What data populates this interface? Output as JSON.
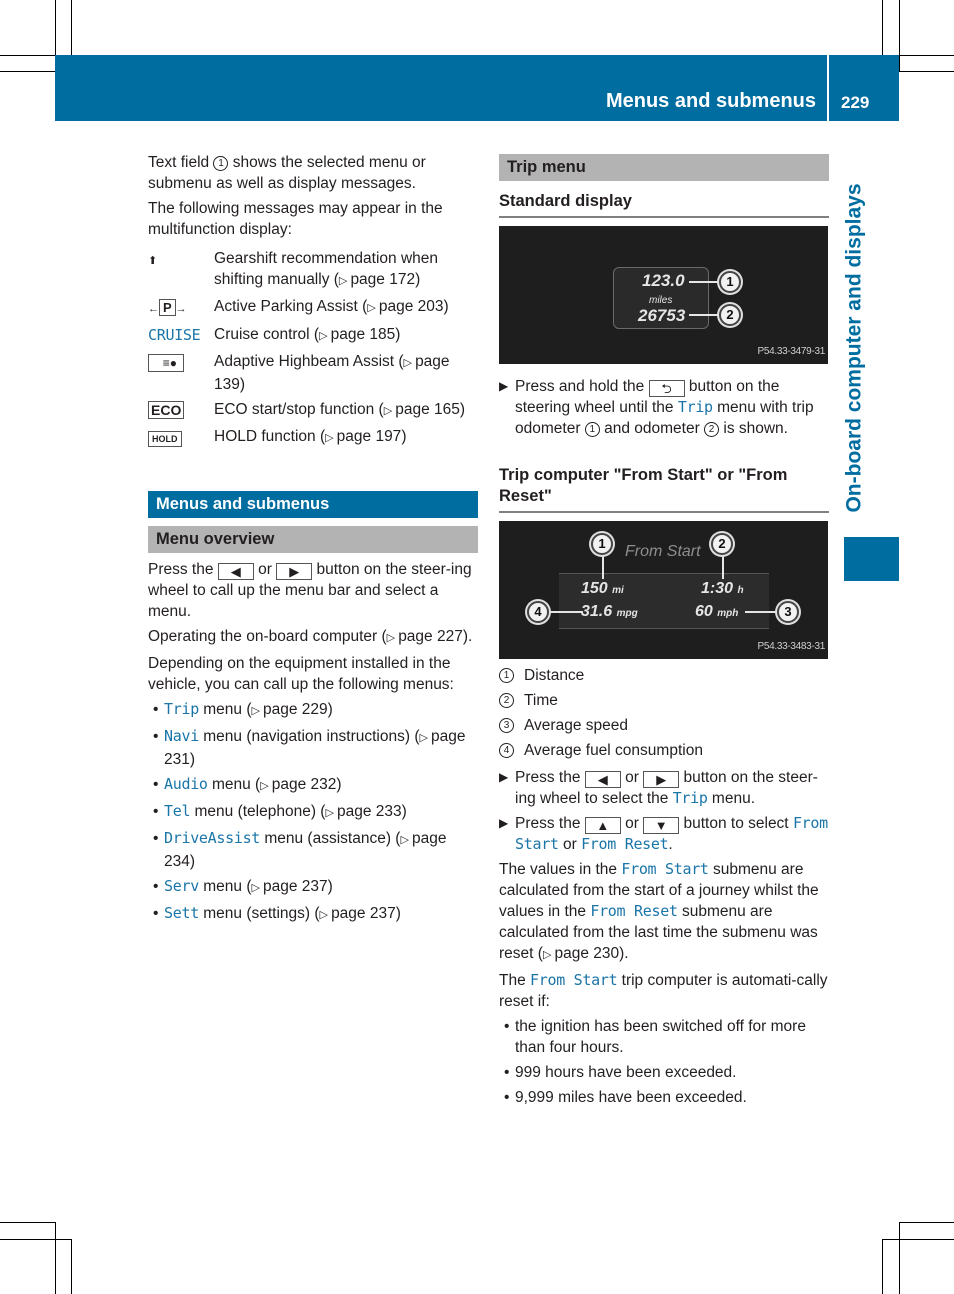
{
  "header": {
    "title": "Menus and submenus",
    "page_number": "229"
  },
  "side_tab": {
    "label": "On-board computer and displays"
  },
  "left": {
    "intro": [
      {
        "before": "Text field ",
        "marker": "1",
        "after": " shows the selected menu or submenu as well as display messages."
      },
      {
        "text": "The following messages may appear in the multifunction display:"
      }
    ],
    "messages": [
      {
        "icon": "gearshift-up-arrow-icon",
        "glyph": "⬆",
        "text": "Gearshift recommendation when shifting manually (",
        "page": "page 172",
        "close": ")"
      },
      {
        "icon": "active-parking-assist-icon",
        "glyph": "P",
        "text": "Active Parking Assist (",
        "page": "page 203",
        "close": ")"
      },
      {
        "icon": "cruise-icon",
        "glyph": "CRUISE",
        "text": "Cruise control (",
        "page": "page 185",
        "close": ")"
      },
      {
        "icon": "adaptive-highbeam-icon",
        "glyph": "≡A",
        "text": "Adaptive Highbeam Assist (",
        "page": "page 139",
        "close": ")"
      },
      {
        "icon": "eco-icon",
        "glyph": "ECO",
        "text": "ECO start/stop function (",
        "page": "page 165",
        "close": ")"
      },
      {
        "icon": "hold-icon",
        "glyph": "HOLD",
        "text": "HOLD function (",
        "page": "page 197",
        "close": ")"
      }
    ],
    "section_title": "Menus and submenus",
    "subsection_title": "Menu overview",
    "para1": {
      "before": "Press the ",
      "btn_left": "◀",
      "mid": " or ",
      "btn_right": "▶",
      "after": " button on the steer-ing wheel to call up the menu bar and select a menu."
    },
    "para2": {
      "text": "Operating the on-board computer (",
      "page": "page 227",
      "close": ")."
    },
    "para3": "Depending on the equipment installed in the vehicle, you can call up the following menus:",
    "menus": [
      {
        "name": "Trip",
        "text": " menu (",
        "page": "page 229",
        "close": ")"
      },
      {
        "name": "Navi",
        "text": " menu (navigation instructions) (",
        "page": "page 231",
        "close": ")"
      },
      {
        "name": "Audio",
        "text": " menu (",
        "page": "page 232",
        "close": ")"
      },
      {
        "name": "Tel",
        "text": " menu (telephone) (",
        "page": "page 233",
        "close": ")"
      },
      {
        "name": "DriveAssist",
        "text": " menu (assistance) (",
        "page": "page 234",
        "close": ")"
      },
      {
        "name": "Serv",
        "text": " menu (",
        "page": "page 237",
        "close": ")"
      },
      {
        "name": "Sett",
        "text": " menu (settings) (",
        "page": "page 237",
        "close": ")"
      }
    ]
  },
  "right": {
    "section_title": "Trip menu",
    "standard_display": {
      "heading": "Standard display",
      "image": {
        "trip_odometer": "123.0",
        "unit": "miles",
        "odometer": "26753",
        "code": "P54.33-3479-31",
        "callouts": [
          "1",
          "2"
        ]
      },
      "step": {
        "before": "Press and hold the ",
        "btn": "⮌",
        "mid": " button on the steering wheel until the ",
        "menu": "Trip",
        "after1": " menu with trip odometer ",
        "m1": "1",
        "after2": " and odometer ",
        "m2": "2",
        "after3": " is shown."
      }
    },
    "trip_computer": {
      "heading": "Trip computer \"From Start\" or \"From Reset\"",
      "image": {
        "title": "From Start",
        "distance": "150",
        "distance_unit": "mi",
        "time": "1:30",
        "time_unit": "h",
        "fuel": "31.6",
        "fuel_unit": "mpg",
        "speed": "60",
        "speed_unit": "mph",
        "code": "P54.33-3483-31",
        "callouts": [
          "1",
          "2",
          "3",
          "4"
        ]
      },
      "legend": [
        {
          "num": "1",
          "label": "Distance"
        },
        {
          "num": "2",
          "label": "Time"
        },
        {
          "num": "3",
          "label": "Average speed"
        },
        {
          "num": "4",
          "label": "Average fuel consumption"
        }
      ],
      "step1": {
        "before": "Press the ",
        "btn_left": "◀",
        "mid": " or ",
        "btn_right": "▶",
        "after": " button on the steer-ing wheel to select the ",
        "menu": "Trip",
        "end": " menu."
      },
      "step2": {
        "before": "Press the ",
        "btn_up": "▲",
        "mid": " or ",
        "btn_down": "▼",
        "after": " button to select ",
        "opt1": "From Start",
        "or": " or ",
        "opt2": "From Reset",
        "end": "."
      },
      "para1": {
        "a": "The values in the ",
        "m1": "From Start",
        "b": " submenu are calculated from the start of a journey whilst the values in the ",
        "m2": "From Reset",
        "c": " submenu are calculated from the last time the submenu was reset (",
        "page": "page 230",
        "d": ")."
      },
      "para2": {
        "a": "The ",
        "m": "From Start",
        "b": " trip computer is automati-cally reset if:"
      },
      "conditions": [
        "the ignition has been switched off for more than four hours.",
        "999 hours have been exceeded.",
        "9,999 miles have been exceeded."
      ]
    }
  },
  "colors": {
    "brand_blue": "#006da0",
    "section_grey": "#b3b3b3",
    "mono_link": "#1a75a8"
  }
}
